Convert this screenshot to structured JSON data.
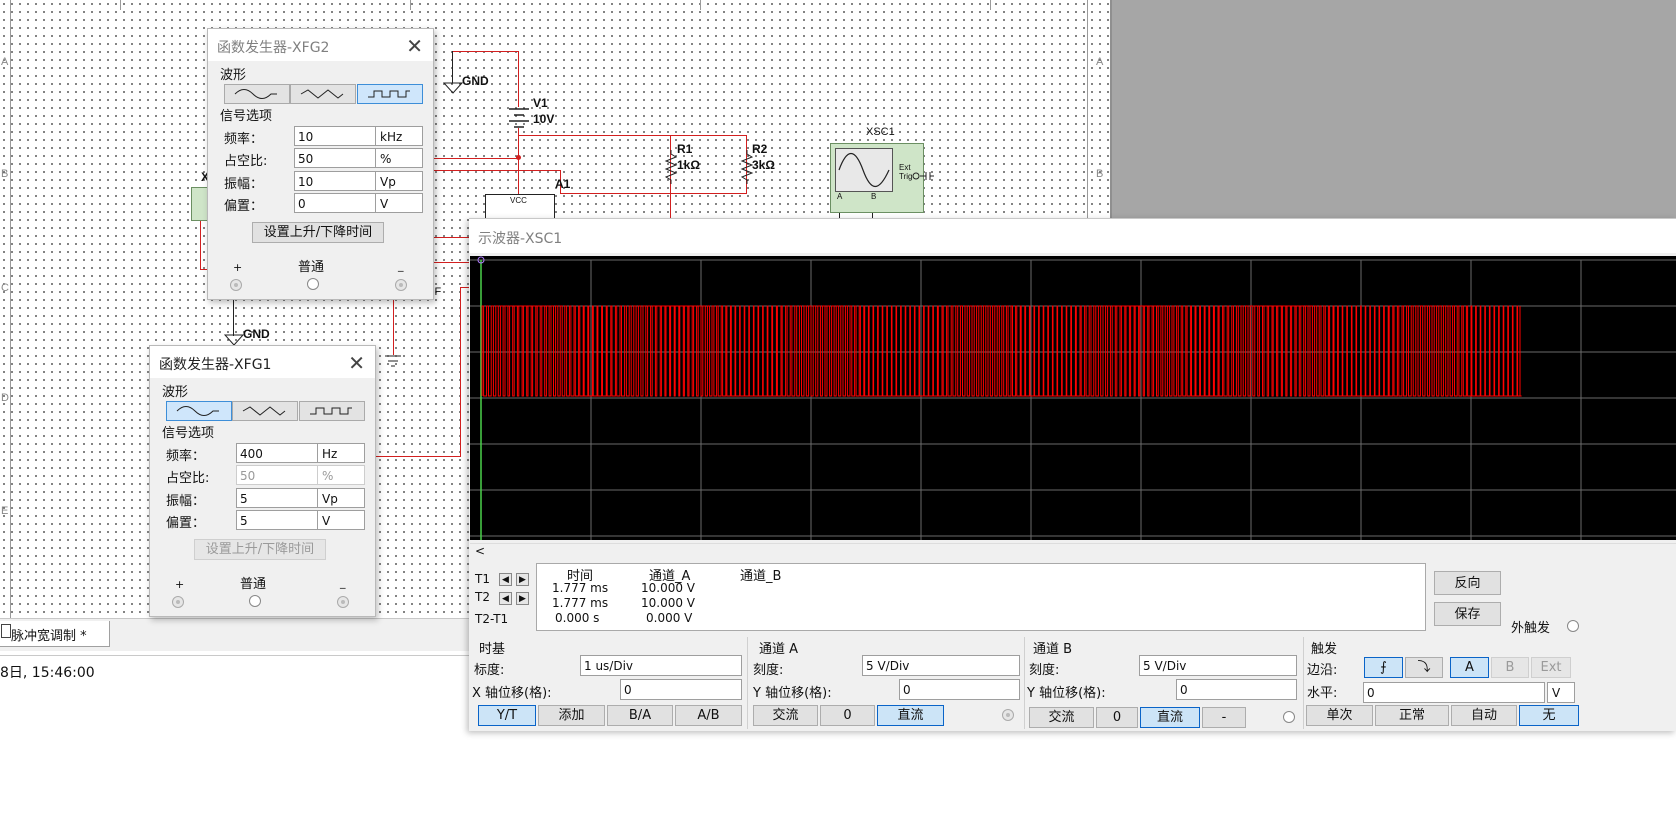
{
  "schematic": {
    "gnd_label": "GND",
    "v1_name": "V1",
    "v1_value": "10V",
    "r1_name": "R1",
    "r1_value": "1kΩ",
    "r2_name": "R2",
    "r2_value": "3kΩ",
    "a1_name": "A1",
    "xsc1_name": "XSC1",
    "ext_trig": "Ext Trig",
    "vcc_label": "VCC",
    "ch_a": "A",
    "ch_b": "B",
    "cap_suffix": "iF",
    "x_label": "X",
    "border_letters": [
      "A",
      "B",
      "C",
      "D",
      "E"
    ]
  },
  "tab": {
    "label": "脉冲宽调制 *"
  },
  "status": {
    "timestamp": "8日, 15:46:00"
  },
  "xfg2": {
    "title": "函数发生器-XFG2",
    "wave_group": "波形",
    "signal_group": "信号选项",
    "freq_label": "频率：",
    "freq_value": "10",
    "freq_unit": "kHz",
    "duty_label": "占空比:",
    "duty_value": "50",
    "duty_unit": "%",
    "amp_label": "振幅：",
    "amp_value": "10",
    "amp_unit": "Vp",
    "offset_label": "偏置：",
    "offset_value": "0",
    "offset_unit": "V",
    "rise_fall_btn": "设置上升/下降时间",
    "plus": "+",
    "common": "普通",
    "minus": "_",
    "selected_wave": "square"
  },
  "xfg1": {
    "title": "函数发生器-XFG1",
    "wave_group": "波形",
    "signal_group": "信号选项",
    "freq_label": "频率：",
    "freq_value": "400",
    "freq_unit": "Hz",
    "duty_label": "占空比:",
    "duty_value": "50",
    "duty_unit": "%",
    "amp_label": "振幅：",
    "amp_value": "5",
    "amp_unit": "Vp",
    "offset_label": "偏置：",
    "offset_value": "5",
    "offset_unit": "V",
    "rise_fall_btn": "设置上升/下降时间",
    "plus": "+",
    "common": "普通",
    "minus": "_",
    "selected_wave": "sine"
  },
  "osc": {
    "title": "示波器-XSC1",
    "scroll_left": "<",
    "readout_headers": {
      "time": "时间",
      "cha": "通道_A",
      "chb": "通道_B"
    },
    "rows": [
      {
        "label": "T1",
        "time": "1.777 ms",
        "cha": "10.000 V",
        "chb": ""
      },
      {
        "label": "T2",
        "time": "1.777 ms",
        "cha": "10.000 V",
        "chb": ""
      },
      {
        "label": "T2-T1",
        "time": "0.000 s",
        "cha": "0.000 V",
        "chb": ""
      }
    ],
    "reverse_btn": "反向",
    "save_btn": "保存",
    "ext_trigger": "外触发",
    "timebase": {
      "title": "时基",
      "scale_label": "标度:",
      "scale_value": "1 us/Div",
      "xpos_label": "X 轴位移(格):",
      "xpos_value": "0",
      "btn_yt": "Y/T",
      "btn_add": "添加",
      "btn_ba": "B/A",
      "btn_ab": "A/B"
    },
    "chA": {
      "title": "通道 A",
      "scale_label": "刻度:",
      "scale_value": "5  V/Div",
      "ypos_label": "Y 轴位移(格):",
      "ypos_value": "0",
      "btn_ac": "交流",
      "btn_zero": "0",
      "btn_dc": "直流"
    },
    "chB": {
      "title": "通道 B",
      "scale_label": "刻度:",
      "scale_value": "5  V/Div",
      "ypos_label": "Y 轴位移(格):",
      "ypos_value": "0",
      "btn_ac": "交流",
      "btn_zero": "0",
      "btn_dc": "直流",
      "btn_minus": "-"
    },
    "trigger": {
      "title": "触发",
      "edge_label": "边沿:",
      "level_label": "水平:",
      "level_value": "0",
      "level_unit": "V",
      "btn_a": "A",
      "btn_b": "B",
      "btn_ext": "Ext",
      "btn_single": "单次",
      "btn_normal": "正常",
      "btn_auto": "自动",
      "btn_none": "无"
    },
    "trace_color": "#ff0000"
  }
}
